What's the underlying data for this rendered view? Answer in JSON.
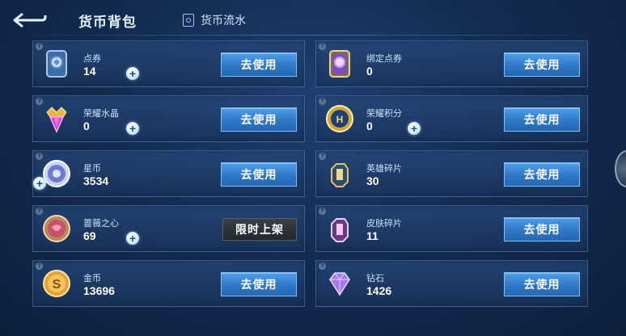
{
  "header": {
    "title": "货币背包",
    "ledger_tab": "货币流水"
  },
  "buttons": {
    "use": "去使用",
    "limited": "限时上架",
    "plus": "+"
  },
  "currencies": [
    {
      "name": "点券",
      "value": "14",
      "icon": "coupon-card-icon",
      "has_plus": true,
      "action": "use"
    },
    {
      "name": "绑定点券",
      "value": "0",
      "icon": "bound-coupon-card-icon",
      "has_plus": false,
      "action": "use"
    },
    {
      "name": "荣耀水晶",
      "value": "0",
      "icon": "glory-crystal-icon",
      "has_plus": true,
      "action": "use"
    },
    {
      "name": "荣耀积分",
      "value": "0",
      "icon": "glory-points-icon",
      "has_plus": true,
      "action": "use"
    },
    {
      "name": "星币",
      "value": "3534",
      "icon": "star-coin-icon",
      "has_plus": true,
      "action": "use"
    },
    {
      "name": "英雄碎片",
      "value": "30",
      "icon": "hero-fragment-icon",
      "has_plus": false,
      "action": "use"
    },
    {
      "name": "蔷薇之心",
      "value": "69",
      "icon": "rose-heart-icon",
      "has_plus": true,
      "action": "limited"
    },
    {
      "name": "皮肤碎片",
      "value": "11",
      "icon": "skin-fragment-icon",
      "has_plus": false,
      "action": "use"
    },
    {
      "name": "金币",
      "value": "13696",
      "icon": "gold-coin-icon",
      "has_plus": false,
      "action": "use"
    },
    {
      "name": "钻石",
      "value": "1426",
      "icon": "diamond-icon",
      "has_plus": false,
      "action": "use"
    }
  ],
  "colors": {
    "background": "#142c52",
    "use_button": "#2f78c8",
    "limited_tag": "#2b3038"
  }
}
